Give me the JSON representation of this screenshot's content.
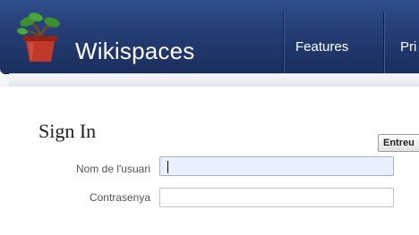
{
  "header": {
    "brand": {
      "name": "Wikispaces",
      "icon": "potted-plant-icon"
    },
    "nav": [
      "Features",
      "Pri"
    ]
  },
  "signin": {
    "title": "Sign In",
    "username_label": "Nom de l'usuari",
    "username_value": "",
    "password_label": "Contrasenya",
    "password_value": "",
    "submit_label": "Entreu"
  },
  "colors": {
    "header_bg": "#223a70",
    "header_text": "#ffffff",
    "input_focus_bg": "#e9f0ff",
    "pot": "#c0392b",
    "leaf": "#3e8e2f"
  }
}
